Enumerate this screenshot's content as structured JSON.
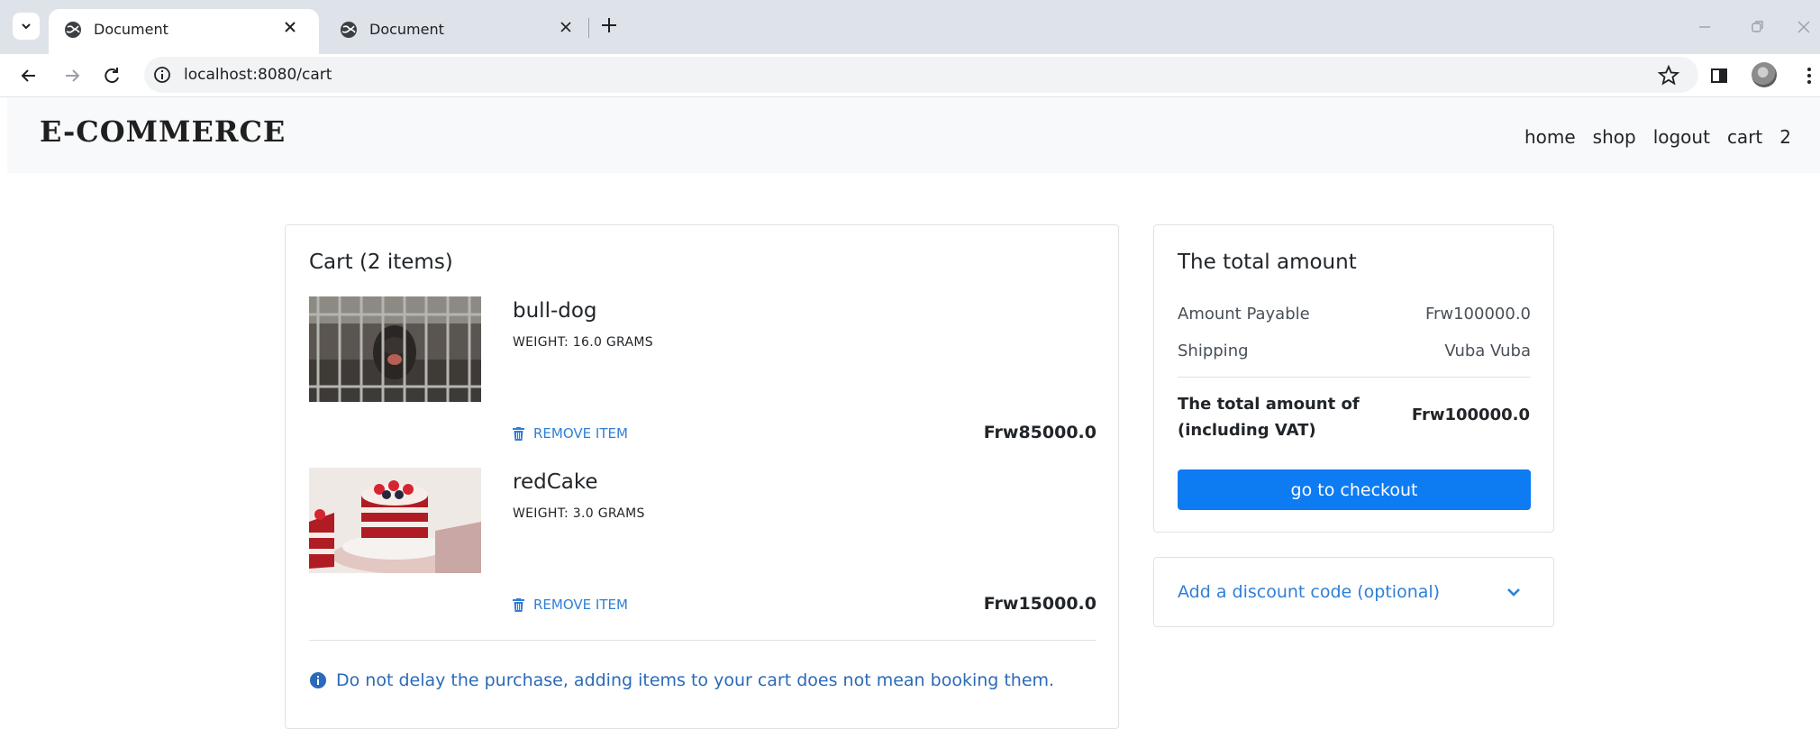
{
  "browser": {
    "tabs": [
      {
        "title": "Document",
        "active": true
      },
      {
        "title": "Document",
        "active": false
      }
    ],
    "url": "localhost:8080/cart"
  },
  "navbar": {
    "brand": "E-COMMERCE",
    "links": [
      "home",
      "shop",
      "logout",
      "cart",
      "2"
    ]
  },
  "cart": {
    "title": "Cart (2 items)",
    "items": [
      {
        "name": "bull-dog",
        "weight": "WEIGHT: 16.0 GRAMS",
        "remove_label": "REMOVE ITEM",
        "price": "Frw85000.0"
      },
      {
        "name": "redCake",
        "weight": "WEIGHT: 3.0 GRAMS",
        "remove_label": "REMOVE ITEM",
        "price": "Frw15000.0"
      }
    ],
    "notice": "Do not delay the purchase, adding items to your cart does not mean booking them."
  },
  "summary": {
    "title": "The total amount",
    "amount_payable_label": "Amount Payable",
    "amount_payable_value": "Frw100000.0",
    "shipping_label": "Shipping",
    "shipping_value": "Vuba Vuba",
    "total_label": "The total amount of (including VAT)",
    "total_value": "Frw100000.0",
    "checkout_label": "go to checkout"
  },
  "discount": {
    "label": "Add a discount code (optional)"
  },
  "colors": {
    "primary_button": "#0d7bf2",
    "link": "#2f7fd6",
    "navbar_bg": "#f8f9fa"
  }
}
